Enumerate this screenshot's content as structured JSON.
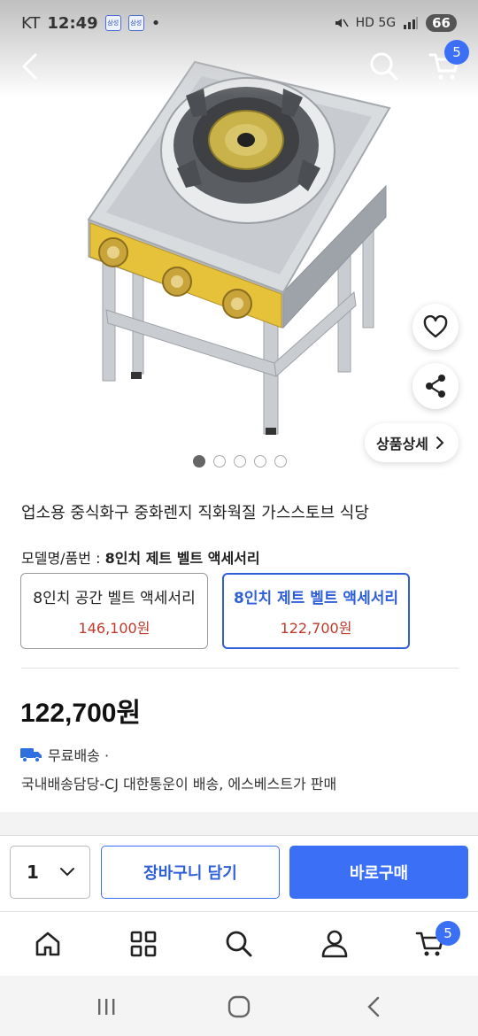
{
  "status_bar": {
    "carrier": "KT",
    "time": "12:49",
    "badge_1": "삼성",
    "badge_2": "삼성",
    "indicators": "HD 5G",
    "battery": "66"
  },
  "header": {
    "back_icon": "chevron-left-icon",
    "search_icon": "search-icon",
    "cart_icon": "cart-icon",
    "cart_count": "5"
  },
  "gallery": {
    "image": "stainless gas wok burner stove",
    "image_count": 5,
    "active_index": 0,
    "detail_button": "상품상세",
    "wishlist_icon": "heart-icon",
    "share_icon": "share-icon"
  },
  "product": {
    "title": "업소용 중식화구 중화렌지 직화웍질 가스스토브 식당",
    "option_label_prefix": "모델명/품번 : ",
    "option_label_value": "8인치 제트 벨트 액세서리",
    "options": [
      {
        "name": "8인치 공간 벨트 액세서리",
        "price": "146,100원",
        "selected": false
      },
      {
        "name": "8인치 제트 벨트 액세서리",
        "price": "122,700원",
        "selected": true
      }
    ],
    "price": "122,700원",
    "shipping": "무료배송 ·",
    "shipping_detail": "국내배송담당-CJ 대한통운이 배송, 에스베스트가 판매"
  },
  "buy_bar": {
    "quantity": "1",
    "add_to_cart": "장바구니 담기",
    "buy_now": "바로구매"
  },
  "tab_bar": {
    "items": [
      "home-icon",
      "category-icon",
      "search-icon",
      "my-page-icon",
      "cart-icon"
    ],
    "cart_count": "5"
  },
  "colors": {
    "accent": "#3b6ff5",
    "price_red": "#c0392b"
  }
}
